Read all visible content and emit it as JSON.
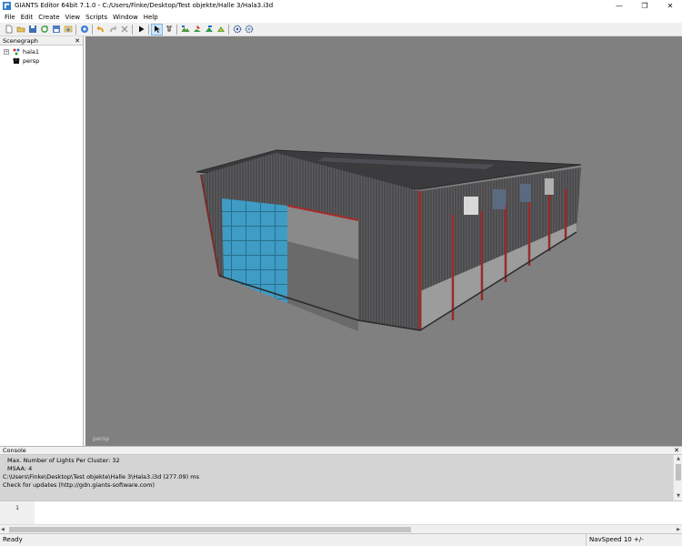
{
  "window": {
    "title": "GIANTS Editor 64bit 7.1.0 - C:/Users/Finke/Desktop/Test objekte/Halle 3/Hala3.i3d",
    "minimize": "—",
    "maximize": "❐",
    "close": "✕"
  },
  "menu": [
    "File",
    "Edit",
    "Create",
    "View",
    "Scripts",
    "Window",
    "Help"
  ],
  "toolbar": {
    "icons": [
      "new-file-icon",
      "open-file-icon",
      "save-icon",
      "refresh-icon",
      "save-as-icon",
      "import-icon",
      "help-icon",
      "undo-icon",
      "redo-icon",
      "delete-icon",
      "play-icon",
      "select-tool-icon",
      "move-tool-icon",
      "terrain-tool-icon",
      "paint-tool-icon",
      "foliage-tool-icon",
      "decal-tool-icon",
      "settings-icon",
      "options-icon"
    ]
  },
  "scenegraph": {
    "title": "Scenegraph",
    "close": "✕",
    "nodes": [
      {
        "label": "hala1",
        "expander": "+"
      },
      {
        "label": "persp",
        "expander": ""
      }
    ]
  },
  "viewport": {
    "camera_label": "persp"
  },
  "console": {
    "title": "Console",
    "lines": [
      "Max. Number of Lights Per Cluster: 32",
      "MSAA: 4",
      "C:\\Users\\Finke\\Desktop\\Test objekte\\Halle 3\\Hala3.i3d (277.09) ms",
      "Check for updates (http://gdn.giants-software.com)"
    ],
    "close": "✕"
  },
  "editor": {
    "line_number": "1"
  },
  "status": {
    "left": "Ready",
    "nav_speed": "NavSpeed 10 +/-"
  }
}
